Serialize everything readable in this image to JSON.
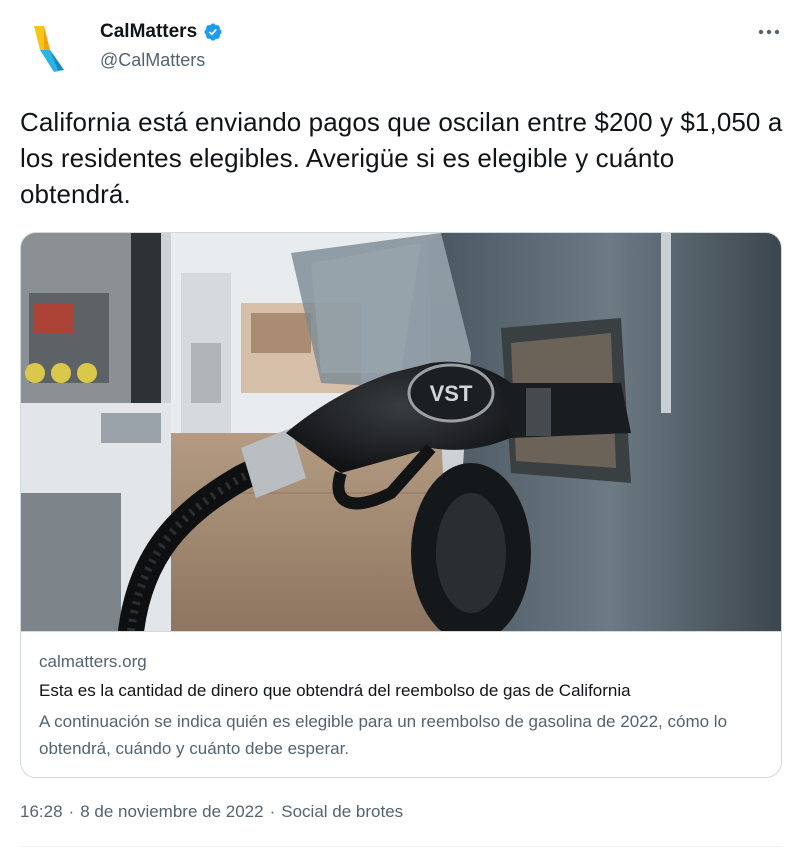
{
  "author": {
    "name": "CalMatters",
    "handle": "@CalMatters",
    "verified_color": "#1d9bf0"
  },
  "tweet": {
    "text": "California está enviando pagos que oscilan entre $200 y $1,050 a los residentes elegibles. Averigüe si es elegible y cuánto obtendrá."
  },
  "card": {
    "domain": "calmatters.org",
    "title": "Esta es la cantidad de dinero que obtendrá del reembolso de gas de California",
    "description": "A continuación se indica quién es elegible para un reembolso de gasolina de 2022, cómo lo obtendrá, cuándo y cuánto debe esperar.",
    "image_text": "VST"
  },
  "meta": {
    "time": "16:28",
    "date": "8 de noviembre de 2022",
    "source": "Social de brotes",
    "separator": "·"
  },
  "icons": {
    "more": "more-horizontal-icon",
    "verified": "verified-badge-icon",
    "logo": "calmatters-logo"
  },
  "colors": {
    "text": "#0f1419",
    "secondary": "#536471",
    "border": "#cfd9de",
    "logo_yellow": "#f5c518",
    "logo_blue": "#2ab3e6"
  }
}
